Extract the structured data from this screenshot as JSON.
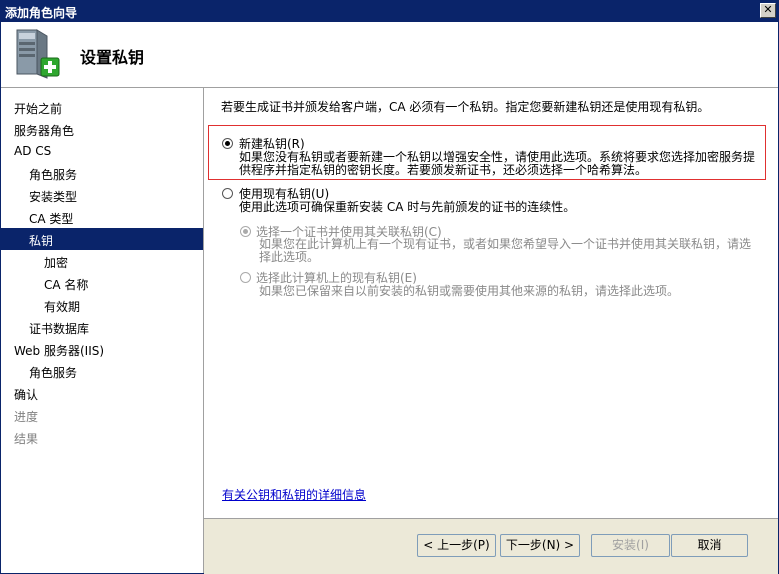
{
  "window": {
    "title": "添加角色向导",
    "close_glyph": "✕"
  },
  "header": {
    "title": "设置私钥",
    "icon": "server-add-icon"
  },
  "sidebar": {
    "items": [
      {
        "label": "开始之前",
        "indent": 0,
        "state": "normal"
      },
      {
        "label": "服务器角色",
        "indent": 0,
        "state": "normal"
      },
      {
        "label": "AD CS",
        "indent": 0,
        "state": "normal"
      },
      {
        "label": "角色服务",
        "indent": 1,
        "state": "normal"
      },
      {
        "label": "安装类型",
        "indent": 1,
        "state": "normal"
      },
      {
        "label": "CA 类型",
        "indent": 1,
        "state": "normal"
      },
      {
        "label": "私钥",
        "indent": 1,
        "state": "selected"
      },
      {
        "label": "加密",
        "indent": 2,
        "state": "normal"
      },
      {
        "label": "CA 名称",
        "indent": 2,
        "state": "normal"
      },
      {
        "label": "有效期",
        "indent": 2,
        "state": "normal"
      },
      {
        "label": "证书数据库",
        "indent": 1,
        "state": "normal"
      },
      {
        "label": "Web 服务器(IIS)",
        "indent": 0,
        "state": "normal"
      },
      {
        "label": "角色服务",
        "indent": 1,
        "state": "normal"
      },
      {
        "label": "确认",
        "indent": 0,
        "state": "normal"
      },
      {
        "label": "进度",
        "indent": 0,
        "state": "dim"
      },
      {
        "label": "结果",
        "indent": 0,
        "state": "dim"
      }
    ]
  },
  "main": {
    "intro": "若要生成证书并颁发给客户端，CA 必须有一个私钥。指定您要新建私钥还是使用现有私钥。",
    "options": {
      "new_key": {
        "label": "新建私钥(R)",
        "desc": "如果您没有私钥或者要新建一个私钥以增强安全性，请使用此选项。系统将要求您选择加密服务提供程序并指定私钥的密钥长度。若要颁发新证书，还必须选择一个哈希算法。",
        "checked": true
      },
      "existing_key": {
        "label": "使用现有私钥(U)",
        "desc": "使用此选项可确保重新安装 CA 时与先前颁发的证书的连续性。",
        "checked": false
      },
      "cert_key": {
        "label": "选择一个证书并使用其关联私钥(C)",
        "desc": "如果您在此计算机上有一个现有证书，或者如果您希望导入一个证书并使用其关联私钥，请选择此选项。",
        "checked": true,
        "disabled": true
      },
      "computer_key": {
        "label": "选择此计算机上的现有私钥(E)",
        "desc": "如果您已保留来自以前安装的私钥或需要使用其他来源的私钥，请选择此选项。",
        "checked": false,
        "disabled": true
      }
    },
    "link": "有关公钥和私钥的详细信息"
  },
  "footer": {
    "prev": "< 上一步(P)",
    "next": "下一步(N) >",
    "install": "安装(I)",
    "cancel": "取消"
  }
}
